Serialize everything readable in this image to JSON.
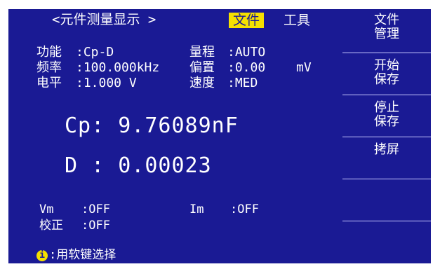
{
  "header": {
    "title": "<元件测量显示 >",
    "tabs": [
      {
        "label": "文件",
        "active": true
      },
      {
        "label": "工具",
        "active": false
      }
    ]
  },
  "params": {
    "func_label": "功能",
    "func_value": ":Cp-D",
    "freq_label": "频率",
    "freq_value": ":100.000kHz",
    "level_label": "电平",
    "level_value": ":1.000 V",
    "range_label": "量程",
    "range_value": ":AUTO",
    "bias_label": "偏置",
    "bias_value": ":0.00",
    "bias_unit": "mV",
    "speed_label": "速度",
    "speed_value": ":MED"
  },
  "measurement": {
    "primary": "Cp: 9.76089nF",
    "secondary": "D : 0.00023"
  },
  "monitor": {
    "vm_label": "Vm",
    "vm_value": ":OFF",
    "im_label": "Im",
    "im_value": ":OFF",
    "corr_label": "校正",
    "corr_value": ":OFF"
  },
  "softkeys": [
    {
      "line1": "文件",
      "line2": "管理"
    },
    {
      "line1": "开始",
      "line2": "保存"
    },
    {
      "line1": "停止",
      "line2": "保存"
    },
    {
      "line1": "拷屏",
      "line2": ""
    },
    {
      "line1": "",
      "line2": ""
    }
  ],
  "hint": {
    "icon": "info-icon",
    "icon_glyph": "i",
    "text": ":用软键选择"
  },
  "colors": {
    "background": "#1a1a94",
    "text": "#ffffff",
    "active_tab": "#f5e000"
  }
}
